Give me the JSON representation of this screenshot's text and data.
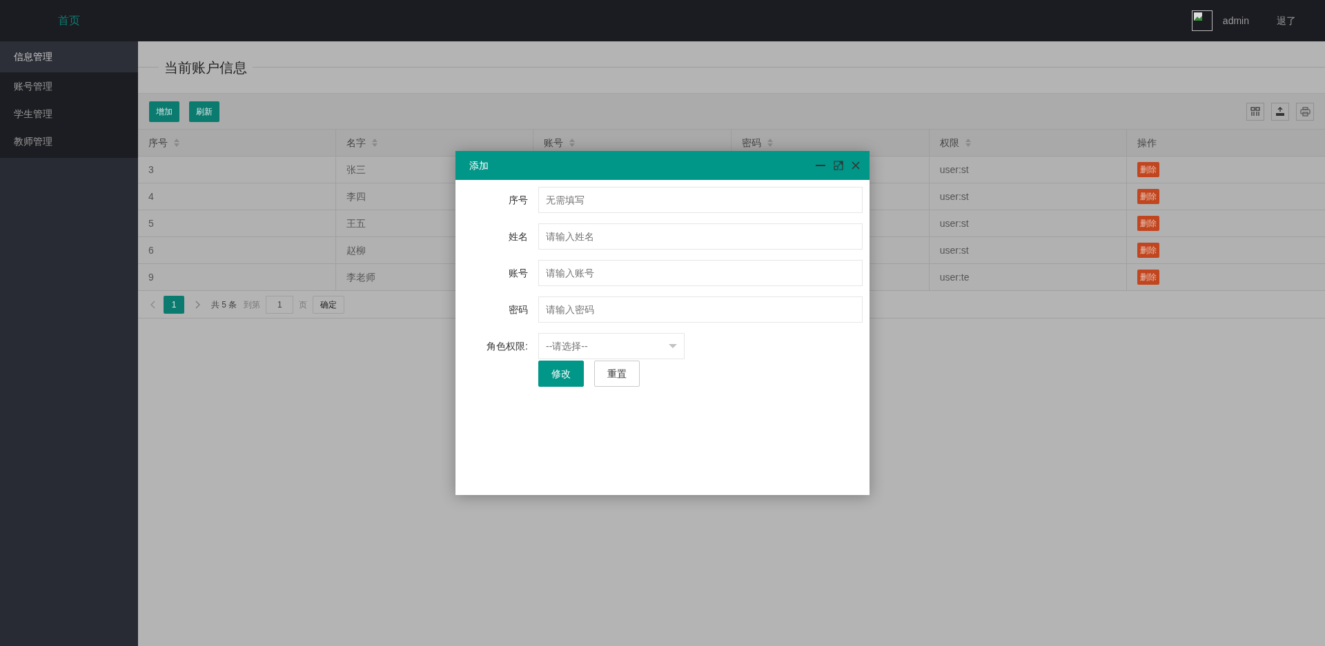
{
  "header": {
    "home_link": "首页",
    "username": "admin",
    "logout": "退了"
  },
  "sidebar": {
    "items": [
      {
        "label": "信息管理",
        "selected": true
      },
      {
        "label": "账号管理",
        "selected": false
      },
      {
        "label": "学生管理",
        "selected": false
      },
      {
        "label": "教师管理",
        "selected": false
      }
    ]
  },
  "page_title": "当前账户信息",
  "toolbar": {
    "buttons": [
      "增加",
      "刷新"
    ]
  },
  "table": {
    "columns": [
      {
        "label": "序号",
        "sortable": true
      },
      {
        "label": "名字",
        "sortable": true
      },
      {
        "label": "账号",
        "sortable": true
      },
      {
        "label": "密码",
        "sortable": true
      },
      {
        "label": "权限",
        "sortable": true
      },
      {
        "label": "操作",
        "sortable": false
      }
    ],
    "rows": [
      {
        "id": "3",
        "name": "张三",
        "role": "user:st",
        "action": "删除"
      },
      {
        "id": "4",
        "name": "李四",
        "role": "user:st",
        "action": "删除"
      },
      {
        "id": "5",
        "name": "王五",
        "role": "user:st",
        "action": "删除"
      },
      {
        "id": "6",
        "name": "赵柳",
        "role": "user:st",
        "action": "删除"
      },
      {
        "id": "9",
        "name": "李老师",
        "role": "user:te",
        "action": "删除"
      }
    ]
  },
  "pagination": {
    "current_page": "1",
    "total": "共 5 条",
    "goto_label": "到第",
    "goto_value": "1",
    "page_unit": "页",
    "confirm": "确定"
  },
  "dialog": {
    "title": "添加",
    "fields": [
      {
        "label": "序号",
        "placeholder": "无需填写"
      },
      {
        "label": "姓名",
        "placeholder": "请输入姓名"
      },
      {
        "label": "账号",
        "placeholder": "请输入账号"
      },
      {
        "label": "密码",
        "placeholder": "请输入密码"
      }
    ],
    "select": {
      "label": "角色权限:",
      "placeholder": "--请选择--"
    },
    "buttons": [
      {
        "label": "修改",
        "kind": "primary"
      },
      {
        "label": "重置",
        "kind": "secondary"
      }
    ]
  }
}
